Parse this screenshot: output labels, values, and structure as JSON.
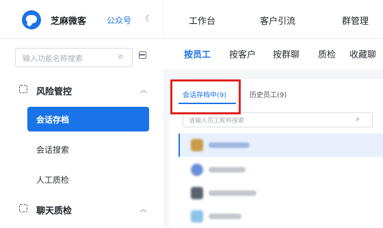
{
  "app": {
    "name": "芝麻微客",
    "account_switch": "公众号"
  },
  "top_nav": [
    "工作台",
    "客户引流",
    "群管理"
  ],
  "sidebar": {
    "search_placeholder": "输入功能名称搜索",
    "groups": [
      {
        "label": "风险管控",
        "items": [
          "会话存档",
          "会话搜索",
          "人工质检"
        ],
        "active_item": "会话存档"
      },
      {
        "label": "聊天质检"
      }
    ]
  },
  "main": {
    "sub_tabs": [
      "按员工",
      "按客户",
      "按群聊",
      "质检",
      "收藏聊"
    ],
    "active_sub_tab": "按员工",
    "panel": {
      "tabs": [
        "会话存档中(9)",
        "历史员工(9)"
      ],
      "active_tab": "会话存档中(9)",
      "employee_search_placeholder": "请输入员工昵称搜索"
    }
  },
  "colors": {
    "accent": "#1a73e8",
    "highlight_box": "#e02020",
    "selected_row": "#e8f0fd"
  },
  "icons": [
    "app-logo-icon",
    "moon-icon",
    "search-icon",
    "layout-toggle-icon",
    "risk-control-icon",
    "chevron-up-icon",
    "chat-inspection-icon"
  ]
}
